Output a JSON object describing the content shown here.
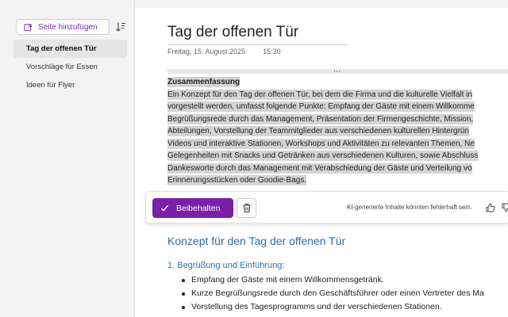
{
  "sidebar": {
    "add_page_label": "Seite hinzufügen",
    "pages": [
      {
        "label": "Tag der offenen Tür",
        "active": true
      },
      {
        "label": "Vorschläge für Essen",
        "active": false
      },
      {
        "label": "Ideen für Flyer",
        "active": false
      }
    ]
  },
  "page": {
    "title": "Tag der offenen Tür",
    "date": "Freitag, 15. August 2025",
    "time": "15:30"
  },
  "summary": {
    "heading": "Zusammenfassung",
    "lines": [
      "Ein Konzept für den Tag der offenen Tür, bei dem die Firma und die kulturelle Vielfalt in",
      "vorgestellt werden, umfasst folgende Punkte: Empfang der Gäste mit einem Willkomme",
      "Begrüßungsrede durch das Management, Präsentation der Firmengeschichte, Mission,",
      "Abteilungen, Vorstellung der Teammitglieder aus verschiedenen kulturellen Hintergrün",
      "Videos und interaktive Stationen, Workshops und Aktivitäten zu relevanten Themen, Ne",
      "Gelegenheiten mit Snacks und Getränken aus verschiedenen Kulturen, sowie Abschluss",
      "Dankesworte durch das Management mit Verabschiedung der Gäste und Verteilung vo",
      "Erinnerungsstücken oder Goodie-Bags."
    ]
  },
  "ai_toolbar": {
    "keep_label": "Beibehalten",
    "disclaimer": "KI-generierte Inhalte könnten fehlerhaft sein."
  },
  "concept": {
    "title": "Konzept für den Tag der offenen Tür",
    "section_heading": "1. Begrüßung und Einführung:",
    "bullets": [
      "Empfang der Gäste mit einem Willkommensgetränk.",
      "Kurze Begrüßungsrede durch den Geschäftsführer oder einen Vertreter des Ma",
      "Vorstellung des Tagesprogramms und der verschiedenen Stationen."
    ]
  },
  "colors": {
    "accent": "#7a1fa8",
    "heading_blue": "#2e6ea6",
    "highlight": "#d4d4d4"
  }
}
